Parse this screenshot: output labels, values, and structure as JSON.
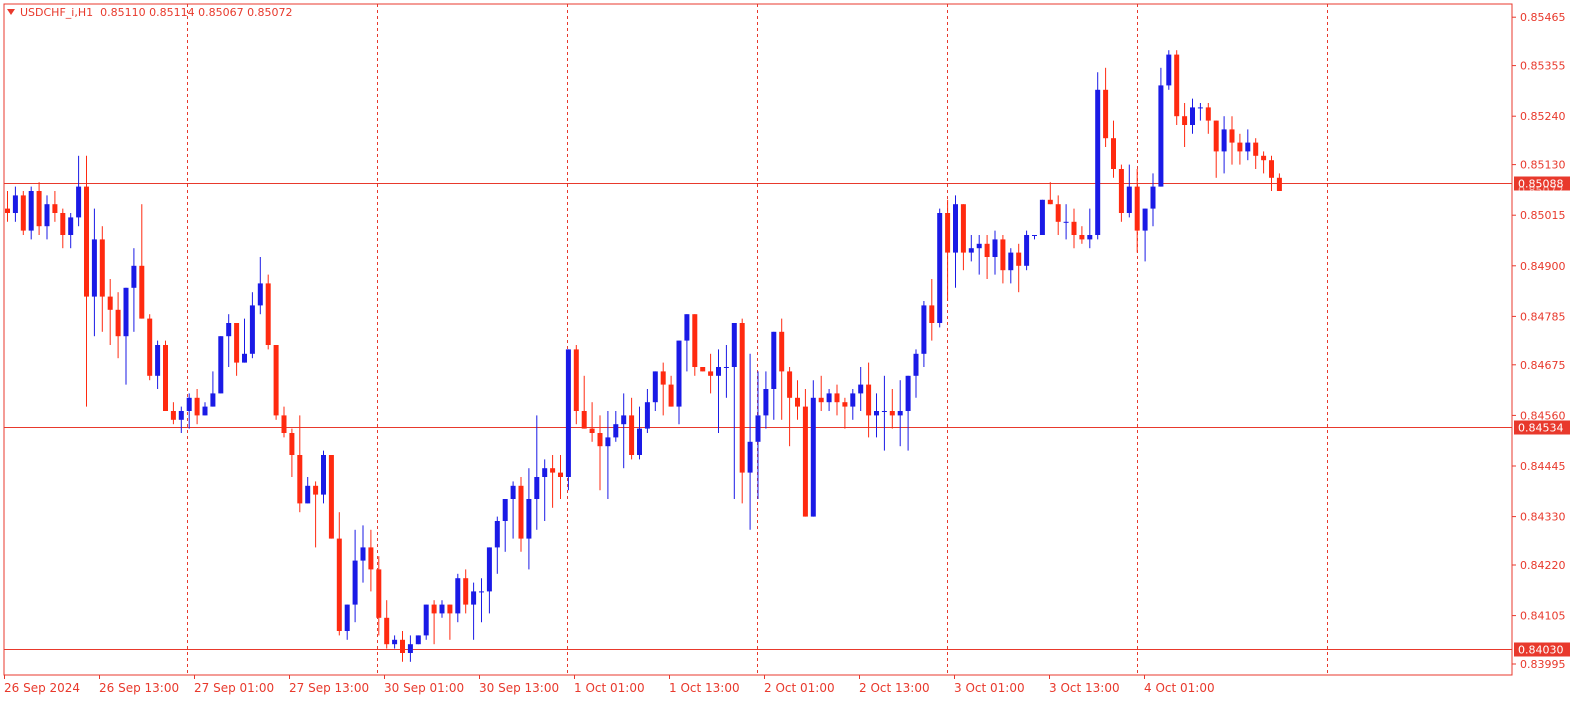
{
  "header": {
    "symbol": "USDCHF_i,H1",
    "ohlc": "0.85110 0.85114 0.85067 0.85072"
  },
  "colors": {
    "bull": "#1a1ae6",
    "bear": "#ff2a10",
    "axis": "#e8392c",
    "grid": "#e8392c",
    "hline": "#e8392c"
  },
  "chart_data": {
    "type": "candlestick",
    "ylim": [
      0.8397,
      0.85495
    ],
    "y_ticks": [
      "0.85465",
      "0.85355",
      "0.85240",
      "0.85130",
      "0.85015",
      "0.84900",
      "0.84785",
      "0.84675",
      "0.84560",
      "0.84445",
      "0.84330",
      "0.84220",
      "0.84105",
      "0.83995"
    ],
    "x_labels": [
      "26 Sep 2024",
      "26 Sep 13:00",
      "27 Sep 01:00",
      "27 Sep 13:00",
      "30 Sep 01:00",
      "30 Sep 13:00",
      "1 Oct 01:00",
      "1 Oct 13:00",
      "2 Oct 01:00",
      "2 Oct 13:00",
      "3 Oct 01:00",
      "3 Oct 13:00",
      "4 Oct 01:00"
    ],
    "horizontal_lines": [
      {
        "price": 0.85088,
        "label": "0.85088"
      },
      {
        "price": 0.84534,
        "label": "0.84534"
      },
      {
        "price": 0.8403,
        "label": "0.84030"
      }
    ],
    "current_price_label": "0.85072",
    "candles": [
      [
        0.8503,
        0.8507,
        0.85,
        0.8502
      ],
      [
        0.8502,
        0.8508,
        0.85,
        0.8506
      ],
      [
        0.8506,
        0.8507,
        0.8497,
        0.8498
      ],
      [
        0.8498,
        0.8508,
        0.8496,
        0.8507
      ],
      [
        0.8507,
        0.8509,
        0.8497,
        0.8499
      ],
      [
        0.8499,
        0.8506,
        0.8496,
        0.8504
      ],
      [
        0.8504,
        0.8507,
        0.85,
        0.8502
      ],
      [
        0.8502,
        0.8503,
        0.8494,
        0.8497
      ],
      [
        0.8497,
        0.8502,
        0.8494,
        0.8501
      ],
      [
        0.8501,
        0.8515,
        0.8499,
        0.8508
      ],
      [
        0.8508,
        0.8515,
        0.8458,
        0.8483
      ],
      [
        0.8483,
        0.8503,
        0.8474,
        0.8496
      ],
      [
        0.8496,
        0.8499,
        0.8475,
        0.8483
      ],
      [
        0.8483,
        0.8487,
        0.8472,
        0.848
      ],
      [
        0.848,
        0.8484,
        0.8469,
        0.8474
      ],
      [
        0.8474,
        0.8485,
        0.8463,
        0.8485
      ],
      [
        0.8485,
        0.8494,
        0.8475,
        0.849
      ],
      [
        0.849,
        0.8504,
        0.8478,
        0.8478
      ],
      [
        0.8478,
        0.8479,
        0.8464,
        0.8465
      ],
      [
        0.8465,
        0.8473,
        0.8462,
        0.8472
      ],
      [
        0.8472,
        0.8473,
        0.8457,
        0.8457
      ],
      [
        0.8457,
        0.8459,
        0.8454,
        0.8455
      ],
      [
        0.8455,
        0.8458,
        0.8452,
        0.8457
      ],
      [
        0.8457,
        0.8461,
        0.8453,
        0.846
      ],
      [
        0.846,
        0.8462,
        0.8454,
        0.8456
      ],
      [
        0.8456,
        0.8459,
        0.8457,
        0.8458
      ],
      [
        0.8458,
        0.8466,
        0.8458,
        0.8461
      ],
      [
        0.8461,
        0.8474,
        0.8461,
        0.8474
      ],
      [
        0.8474,
        0.8479,
        0.8467,
        0.8477
      ],
      [
        0.8477,
        0.8474,
        0.8465,
        0.8468
      ],
      [
        0.8468,
        0.8478,
        0.8468,
        0.847
      ],
      [
        0.847,
        0.8484,
        0.8469,
        0.8481
      ],
      [
        0.8481,
        0.8492,
        0.8479,
        0.8486
      ],
      [
        0.8486,
        0.8488,
        0.8471,
        0.8472
      ],
      [
        0.8472,
        0.8472,
        0.8455,
        0.8456
      ],
      [
        0.8456,
        0.8458,
        0.8451,
        0.8452
      ],
      [
        0.8452,
        0.8453,
        0.8442,
        0.8447
      ],
      [
        0.8447,
        0.8456,
        0.8434,
        0.8436
      ],
      [
        0.8436,
        0.8442,
        0.8436,
        0.844
      ],
      [
        0.844,
        0.8441,
        0.8426,
        0.8438
      ],
      [
        0.8438,
        0.8448,
        0.8436,
        0.8447
      ],
      [
        0.8447,
        0.8447,
        0.8428,
        0.8428
      ],
      [
        0.8428,
        0.8434,
        0.8406,
        0.8407
      ],
      [
        0.8407,
        0.8411,
        0.8405,
        0.8413
      ],
      [
        0.8413,
        0.843,
        0.8409,
        0.8423
      ],
      [
        0.8423,
        0.8431,
        0.8418,
        0.8426
      ],
      [
        0.8426,
        0.843,
        0.8416,
        0.8421
      ],
      [
        0.8421,
        0.8424,
        0.8406,
        0.841
      ],
      [
        0.841,
        0.8414,
        0.8403,
        0.8404
      ],
      [
        0.8404,
        0.8406,
        0.8403,
        0.8405
      ],
      [
        0.8405,
        0.8407,
        0.84,
        0.8402
      ],
      [
        0.8402,
        0.8406,
        0.84,
        0.8404
      ],
      [
        0.8404,
        0.8405,
        0.8404,
        0.8406
      ],
      [
        0.8406,
        0.8411,
        0.8405,
        0.8413
      ],
      [
        0.8413,
        0.8414,
        0.8404,
        0.8411
      ],
      [
        0.8411,
        0.8414,
        0.841,
        0.8413
      ],
      [
        0.8413,
        0.8413,
        0.8405,
        0.8411
      ],
      [
        0.8411,
        0.842,
        0.8409,
        0.8419
      ],
      [
        0.8419,
        0.8421,
        0.8411,
        0.8413
      ],
      [
        0.8413,
        0.8418,
        0.8405,
        0.8416
      ],
      [
        0.8416,
        0.8419,
        0.8409,
        0.8416
      ],
      [
        0.8416,
        0.8426,
        0.8411,
        0.8426
      ],
      [
        0.8426,
        0.8433,
        0.842,
        0.8432
      ],
      [
        0.8432,
        0.8437,
        0.8425,
        0.8437
      ],
      [
        0.8437,
        0.8441,
        0.8428,
        0.844
      ],
      [
        0.844,
        0.8442,
        0.8425,
        0.8428
      ],
      [
        0.8428,
        0.8444,
        0.8421,
        0.8437
      ],
      [
        0.8437,
        0.8456,
        0.843,
        0.8442
      ],
      [
        0.8442,
        0.8446,
        0.8432,
        0.8444
      ],
      [
        0.8444,
        0.8447,
        0.8435,
        0.8443
      ],
      [
        0.8443,
        0.8447,
        0.8437,
        0.8442
      ],
      [
        0.8442,
        0.8471,
        0.8439,
        0.8471
      ],
      [
        0.8471,
        0.8472,
        0.8454,
        0.8457
      ],
      [
        0.8457,
        0.8465,
        0.8453,
        0.8453
      ],
      [
        0.8453,
        0.8459,
        0.845,
        0.8452
      ],
      [
        0.8452,
        0.8456,
        0.8439,
        0.8449
      ],
      [
        0.8449,
        0.8457,
        0.8437,
        0.8451
      ],
      [
        0.8451,
        0.8457,
        0.845,
        0.8454
      ],
      [
        0.8454,
        0.8461,
        0.8444,
        0.8456
      ],
      [
        0.8456,
        0.846,
        0.8446,
        0.8447
      ],
      [
        0.8447,
        0.8458,
        0.8446,
        0.8453
      ],
      [
        0.8453,
        0.8462,
        0.8452,
        0.8459
      ],
      [
        0.8459,
        0.8465,
        0.8457,
        0.8466
      ],
      [
        0.8466,
        0.8468,
        0.8456,
        0.8463
      ],
      [
        0.8463,
        0.8465,
        0.846,
        0.8458
      ],
      [
        0.8458,
        0.847,
        0.8454,
        0.8473
      ],
      [
        0.8473,
        0.8479,
        0.8466,
        0.8479
      ],
      [
        0.8479,
        0.8479,
        0.8465,
        0.8467
      ],
      [
        0.8467,
        0.8467,
        0.8466,
        0.8466
      ],
      [
        0.8466,
        0.847,
        0.8461,
        0.8465
      ],
      [
        0.8465,
        0.8471,
        0.8452,
        0.8467
      ],
      [
        0.8467,
        0.8472,
        0.846,
        0.8467
      ],
      [
        0.8467,
        0.8477,
        0.8437,
        0.8477
      ],
      [
        0.8477,
        0.8478,
        0.8436,
        0.8443
      ],
      [
        0.8443,
        0.847,
        0.843,
        0.845
      ],
      [
        0.845,
        0.8466,
        0.8437,
        0.8456
      ],
      [
        0.8456,
        0.8466,
        0.8453,
        0.8462
      ],
      [
        0.8462,
        0.8473,
        0.8455,
        0.8475
      ],
      [
        0.8475,
        0.8478,
        0.8455,
        0.8466
      ],
      [
        0.8466,
        0.8467,
        0.8449,
        0.846
      ],
      [
        0.846,
        0.8464,
        0.8455,
        0.8458
      ],
      [
        0.8458,
        0.8462,
        0.8435,
        0.8433
      ],
      [
        0.8433,
        0.8464,
        0.8433,
        0.846
      ],
      [
        0.846,
        0.8465,
        0.8457,
        0.8459
      ],
      [
        0.8459,
        0.8462,
        0.8457,
        0.8461
      ],
      [
        0.8461,
        0.8463,
        0.8456,
        0.8459
      ],
      [
        0.8459,
        0.846,
        0.8453,
        0.8458
      ],
      [
        0.8458,
        0.8462,
        0.8455,
        0.8461
      ],
      [
        0.8461,
        0.8467,
        0.8457,
        0.8463
      ],
      [
        0.8463,
        0.8468,
        0.8451,
        0.8456
      ],
      [
        0.8456,
        0.8461,
        0.8451,
        0.8457
      ],
      [
        0.8457,
        0.8465,
        0.8448,
        0.8457
      ],
      [
        0.8457,
        0.8462,
        0.8453,
        0.8456
      ],
      [
        0.8456,
        0.8464,
        0.8449,
        0.8457
      ],
      [
        0.8457,
        0.8465,
        0.8448,
        0.8465
      ],
      [
        0.8465,
        0.8471,
        0.846,
        0.847
      ],
      [
        0.847,
        0.8482,
        0.8467,
        0.8481
      ],
      [
        0.8481,
        0.8487,
        0.8473,
        0.8477
      ],
      [
        0.8477,
        0.8503,
        0.8476,
        0.8502
      ],
      [
        0.8502,
        0.8505,
        0.8482,
        0.8493
      ],
      [
        0.8493,
        0.8506,
        0.8485,
        0.8504
      ],
      [
        0.8504,
        0.8504,
        0.8489,
        0.8493
      ],
      [
        0.8493,
        0.8497,
        0.8491,
        0.8494
      ],
      [
        0.8494,
        0.8497,
        0.8488,
        0.8495
      ],
      [
        0.8495,
        0.8497,
        0.8487,
        0.8492
      ],
      [
        0.8492,
        0.8498,
        0.8488,
        0.8496
      ],
      [
        0.8496,
        0.8497,
        0.8486,
        0.8489
      ],
      [
        0.8489,
        0.8494,
        0.8486,
        0.8493
      ],
      [
        0.8493,
        0.8495,
        0.8484,
        0.849
      ],
      [
        0.849,
        0.8498,
        0.8489,
        0.8497
      ],
      [
        0.8497,
        0.8496,
        0.8496,
        0.8497
      ],
      [
        0.8497,
        0.8505,
        0.8497,
        0.8505
      ],
      [
        0.8505,
        0.8509,
        0.8504,
        0.8504
      ],
      [
        0.8504,
        0.8506,
        0.8497,
        0.85
      ],
      [
        0.85,
        0.8504,
        0.8496,
        0.85
      ],
      [
        0.85,
        0.8503,
        0.8494,
        0.8497
      ],
      [
        0.8497,
        0.8499,
        0.8495,
        0.8496
      ],
      [
        0.8496,
        0.8503,
        0.8494,
        0.8497
      ],
      [
        0.8497,
        0.8534,
        0.8496,
        0.853
      ],
      [
        0.853,
        0.8535,
        0.8517,
        0.8519
      ],
      [
        0.8519,
        0.8523,
        0.851,
        0.8512
      ],
      [
        0.8512,
        0.8513,
        0.85,
        0.8502
      ],
      [
        0.8502,
        0.8513,
        0.8501,
        0.8508
      ],
      [
        0.8508,
        0.8512,
        0.8493,
        0.8498
      ],
      [
        0.8498,
        0.8503,
        0.8491,
        0.8503
      ],
      [
        0.8503,
        0.8511,
        0.8499,
        0.8508
      ],
      [
        0.8508,
        0.8535,
        0.8508,
        0.8531
      ],
      [
        0.8531,
        0.8539,
        0.853,
        0.8538
      ],
      [
        0.8538,
        0.8539,
        0.8522,
        0.8524
      ],
      [
        0.8524,
        0.8527,
        0.8517,
        0.8522
      ],
      [
        0.8522,
        0.8528,
        0.852,
        0.8526
      ],
      [
        0.8526,
        0.8527,
        0.8523,
        0.8526
      ],
      [
        0.8526,
        0.8527,
        0.852,
        0.8523
      ],
      [
        0.8523,
        0.8523,
        0.851,
        0.8516
      ],
      [
        0.8516,
        0.8524,
        0.8511,
        0.8521
      ],
      [
        0.8521,
        0.8524,
        0.8513,
        0.8518
      ],
      [
        0.8518,
        0.852,
        0.8513,
        0.8516
      ],
      [
        0.8516,
        0.8521,
        0.8514,
        0.8518
      ],
      [
        0.8518,
        0.8519,
        0.8512,
        0.8515
      ],
      [
        0.8515,
        0.8516,
        0.8511,
        0.8514
      ],
      [
        0.8514,
        0.8515,
        0.8507,
        0.851
      ],
      [
        0.851,
        0.8511,
        0.8507,
        0.8507
      ]
    ]
  }
}
